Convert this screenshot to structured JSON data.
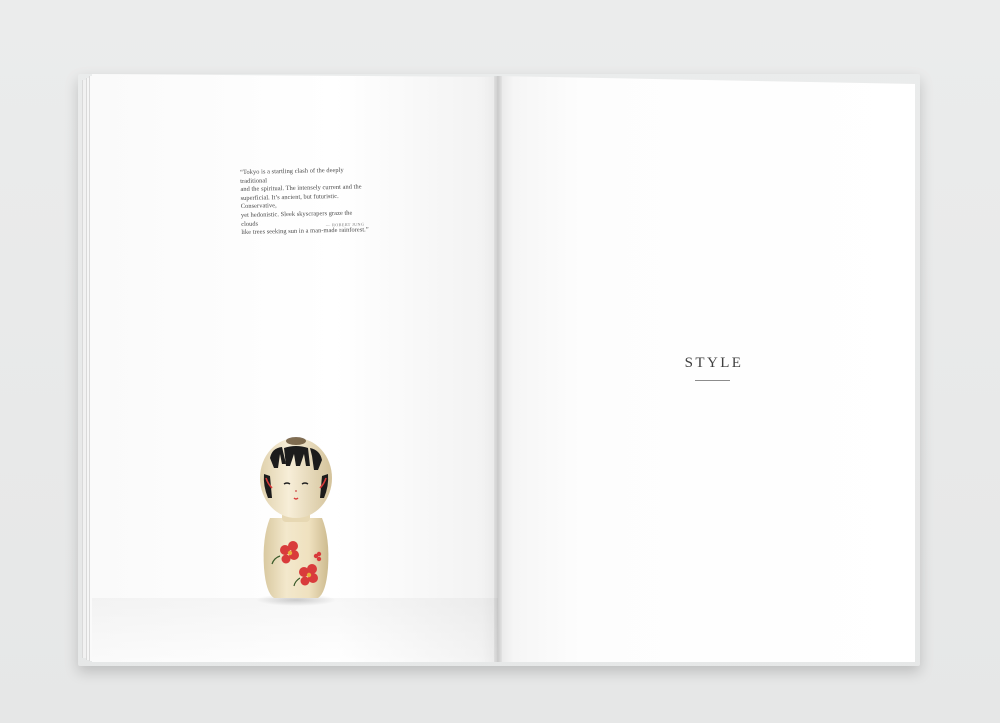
{
  "spread": {
    "quote": {
      "line_1": "“Tokyo is a startling clash of the deeply traditional",
      "line_2": "and the spiritual. The intensely current and the",
      "line_3": "superficial. It’s ancient, but futuristic. Conservative,",
      "line_4": "yet hedonistic. Sleek skyscrapers graze the clouds",
      "line_5": "like trees seeking sun in a man-made rainforest.”",
      "attribution": "— Robert Jung"
    },
    "section_title": "STYLE"
  },
  "colors": {
    "background": "#e8e9e9",
    "paper": "#ffffff",
    "text": "#3f3f3f",
    "doll_body": "#efe3c4",
    "doll_hair": "#1c1c1c",
    "doll_flower": "#d93b3b",
    "doll_flower_center": "#e8b13a"
  },
  "images": {
    "doll": "kokeshi-doll"
  }
}
